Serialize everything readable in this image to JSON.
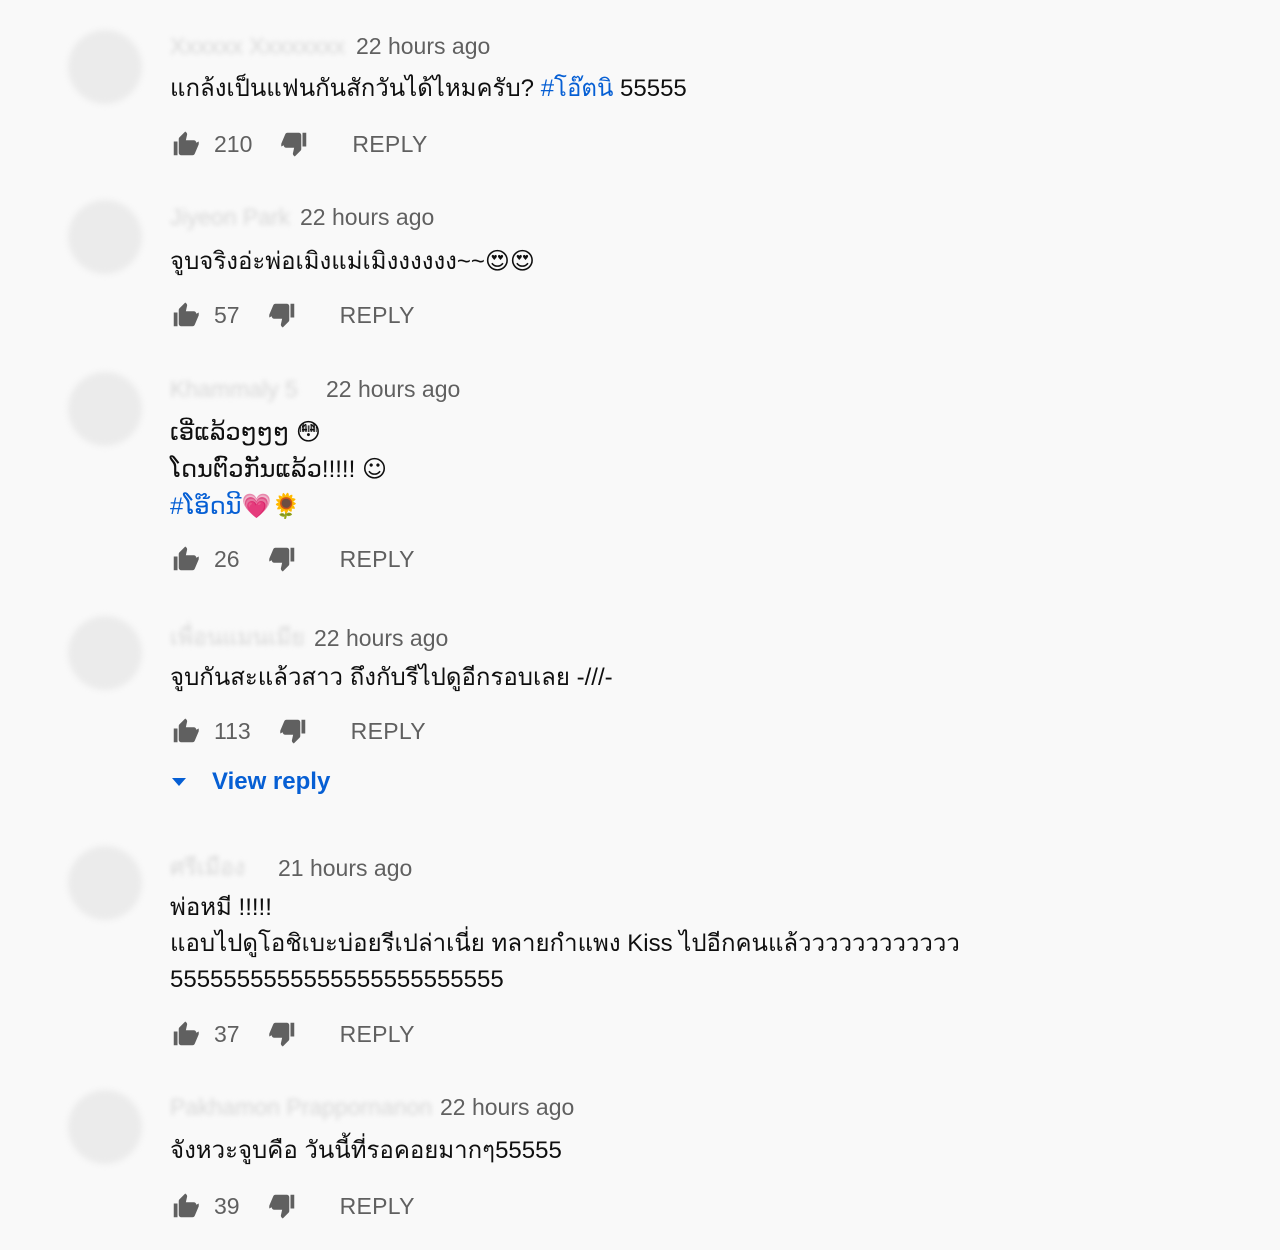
{
  "comments": [
    {
      "author": "Xxxxxx Xxxxxxxx",
      "time": "22 hours ago",
      "lines": [
        {
          "parts": [
            {
              "t": "แกล้งเป็นแฟนกันสักวันได้ไหมครับ? "
            },
            {
              "t": "#โอ๊ตนิ",
              "tag": true
            },
            {
              "t": " 55555"
            }
          ]
        }
      ],
      "likes": "210",
      "reply_label": "REPLY"
    },
    {
      "author": "Jiyeon Park",
      "time": "22 hours ago",
      "lines": [
        {
          "parts": [
            {
              "t": "จูบจริงอ่ะพ่อเมิงแม่เมิงงงงงง~~"
            },
            {
              "t": "😍😍",
              "emoji": true
            }
          ]
        }
      ],
      "likes": "57",
      "reply_label": "REPLY"
    },
    {
      "author": "Khammaly 5",
      "time": "22 hours ago",
      "lines": [
        {
          "parts": [
            {
              "t": "ເອີ່ແລ້ວໆໆໆ "
            },
            {
              "t": "😳",
              "emoji": true
            }
          ]
        },
        {
          "parts": [
            {
              "t": "ໂດນຕົວກັນແລ້ວ!!!!! "
            },
            {
              "t": "☺",
              "emoji": true
            }
          ]
        },
        {
          "parts": [
            {
              "t": "#ໂອ໊ດນີ",
              "tag": true
            },
            {
              "t": "💗🌻",
              "emoji": true
            }
          ]
        }
      ],
      "likes": "26",
      "reply_label": "REPLY"
    },
    {
      "author": "เพื่อนแมนเมีย",
      "time": "22 hours ago",
      "lines": [
        {
          "parts": [
            {
              "t": "จูบกันสะแล้วสาว ถึงกับรีไปดูอีกรอบเลย -///-"
            }
          ]
        }
      ],
      "likes": "113",
      "reply_label": "REPLY",
      "view_reply": "View reply"
    },
    {
      "author": "ศรีเมือง",
      "time": "21 hours ago",
      "lines": [
        {
          "parts": [
            {
              "t": "พ่อหมี !!!!!"
            }
          ]
        },
        {
          "parts": [
            {
              "t": "แอบไปดูโอชิเบะบ่อยรีเปล่าเนี่ย ทลายกำแพง Kiss ไปอีกคนแล้วววววววววววว"
            }
          ]
        },
        {
          "parts": [
            {
              "t": "5555555555555555555555555"
            }
          ]
        }
      ],
      "likes": "37",
      "reply_label": "REPLY"
    },
    {
      "author": "Pakhamon Prappornanon",
      "time": "22 hours ago",
      "lines": [
        {
          "parts": [
            {
              "t": "จังหวะจูบคือ วันนี้ที่รอคอยมากๆ55555"
            }
          ]
        }
      ],
      "likes": "39",
      "reply_label": "REPLY"
    }
  ]
}
